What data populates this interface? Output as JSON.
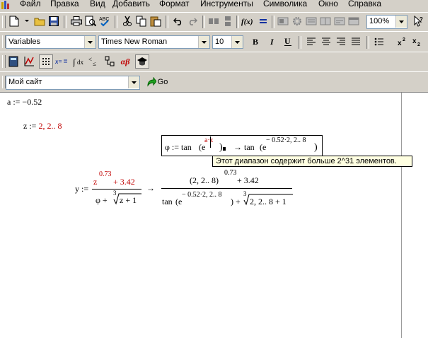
{
  "menu": [
    "Файл",
    "Правка",
    "Вид",
    "Добавить",
    "Формат",
    "Инструменты",
    "Символика",
    "Окно",
    "Справка"
  ],
  "toolbar": {
    "zoom_value": "100%"
  },
  "format_bar": {
    "style": "Variables",
    "font": "Times New Roman",
    "size": "10"
  },
  "resource_bar": {
    "site": "Мой сайт",
    "go_label": "Go"
  },
  "math_palette": {
    "alpha_beta": "αβ"
  },
  "worksheet": {
    "a_def": "a := −0.52",
    "z_label": "z := ",
    "z_value": "2, 2.. 8",
    "phi_lhs": "φ := tan",
    "phi_e": "(e",
    "phi_exp": "a·z",
    "phi_rparen": ")",
    "arrow1": "→ tan",
    "phi_result_e": "(e",
    "phi_result_exp": "− 0.52·2, 2.. 8",
    "phi_result_close": ")",
    "y_lhs": "y :=",
    "y_num_z": "z",
    "y_num_exp": "0.73",
    "y_num_rest": " + 3.42",
    "y_den": "φ +",
    "y_den_root_idx": "3",
    "y_den_root": "z + 1",
    "arrow2": "→",
    "y_r_num_base": "(2, 2.. 8)",
    "y_r_num_exp": "0.73",
    "y_r_num_rest": " + 3.42",
    "y_r_den_tan": "tan",
    "y_r_den_e": "(e",
    "y_r_den_exp": "− 0.52·2, 2.. 8",
    "y_r_den_close": ") +",
    "y_r_den_root_idx": "3",
    "y_r_den_root": "2, 2.. 8 + 1"
  },
  "tooltip": "Этот диапазон содержит больше 2^31 элементов."
}
